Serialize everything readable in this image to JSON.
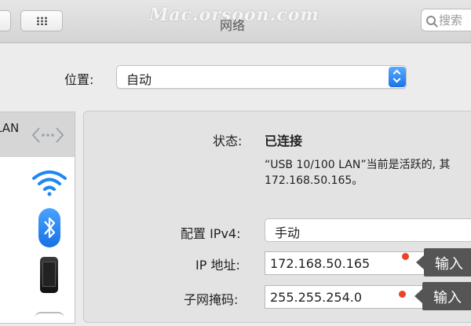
{
  "window": {
    "title": "网络",
    "watermark": "Mac.orsoon.com",
    "search_placeholder": "搜索"
  },
  "location": {
    "label": "位置:",
    "value": "自动"
  },
  "sidebar": {
    "items": [
      {
        "label": "LAN",
        "icon": "ethernet-icon",
        "selected": true
      },
      {
        "label": "",
        "icon": "wifi-icon"
      },
      {
        "label": "",
        "icon": "bluetooth-icon"
      },
      {
        "label": "",
        "icon": "iphone-icon"
      }
    ]
  },
  "details": {
    "status_label": "状态:",
    "status_value": "已连接",
    "status_desc_line1": "“USB 10/100 LAN”当前是活跃的, 其",
    "status_desc_line2": "172.168.50.165。",
    "configure_label": "配置 IPv4:",
    "configure_value": "手动",
    "ip_label": "IP 地址:",
    "ip_value": "172.168.50.165",
    "mask_label": "子网掩码:",
    "mask_value": "255.255.254.0"
  },
  "annotations": {
    "ip_callout": "输入",
    "mask_callout": "输入",
    "marker_color": "#e8442a"
  },
  "colors": {
    "accent": "#1a72e8",
    "callout_bg": "#555555"
  }
}
